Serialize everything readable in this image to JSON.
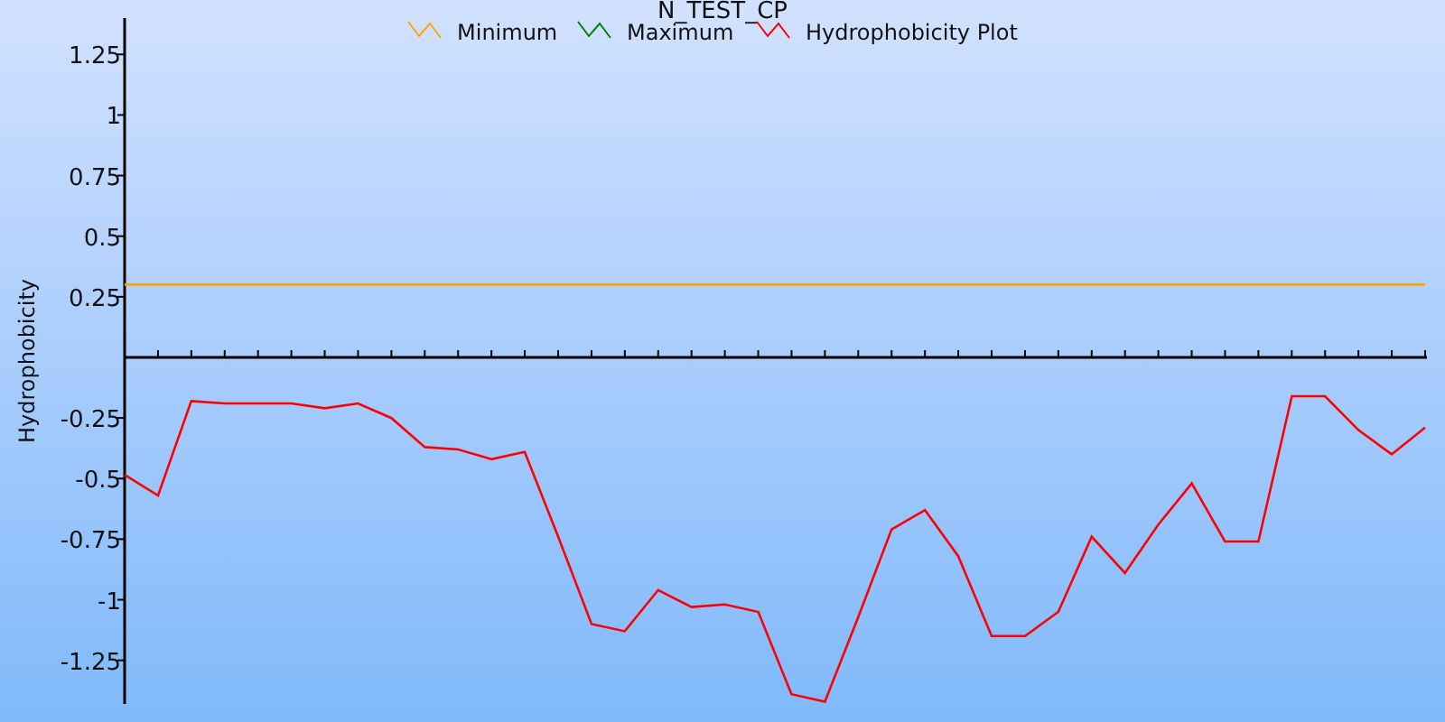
{
  "chart_data": {
    "type": "line",
    "title": "N_TEST_CP",
    "ylabel": "Hydrophobicity",
    "legend": "top",
    "ylim": [
      -1.43,
      1.4
    ],
    "yticks": [
      1.25,
      1,
      0.75,
      0.5,
      0.25,
      -0.25,
      -0.5,
      -0.75,
      -1,
      -1.25
    ],
    "series": [
      {
        "name": "Minimum",
        "color": "#ffa500",
        "values": [
          0.3,
          0.3,
          0.3,
          0.3,
          0.3,
          0.3,
          0.3,
          0.3,
          0.3,
          0.3,
          0.3,
          0.3,
          0.3,
          0.3,
          0.3,
          0.3,
          0.3,
          0.3,
          0.3,
          0.3,
          0.3,
          0.3,
          0.3,
          0.3,
          0.3,
          0.3,
          0.3,
          0.3,
          0.3,
          0.3,
          0.3,
          0.3,
          0.3,
          0.3,
          0.3,
          0.3,
          0.3,
          0.3,
          0.3,
          0.3
        ]
      },
      {
        "name": "Maximum",
        "color": "#008000",
        "values": [
          null,
          null,
          null,
          null,
          null,
          null,
          null,
          null,
          null,
          null,
          null,
          null,
          null,
          null,
          null,
          null,
          null,
          null,
          null,
          null,
          null,
          null,
          null,
          null,
          null,
          null,
          null,
          null,
          null,
          null,
          null,
          null,
          null,
          null,
          null,
          null,
          null,
          null,
          null,
          null
        ]
      },
      {
        "name": "Hydrophobicity Plot",
        "color": "#ff0000",
        "values": [
          -0.485,
          -0.57,
          -0.18,
          -0.19,
          -0.19,
          -0.19,
          -0.21,
          -0.19,
          -0.25,
          -0.37,
          -0.38,
          -0.42,
          -0.39,
          -0.74,
          -1.1,
          -1.13,
          -0.96,
          -1.03,
          -1.02,
          -1.05,
          -1.39,
          -1.42,
          -1.07,
          -0.71,
          -0.63,
          -0.82,
          -1.15,
          -1.15,
          -1.05,
          -0.74,
          -0.89,
          -0.69,
          -0.52,
          -0.76,
          -0.76,
          -0.16,
          -0.16,
          -0.3,
          -0.4,
          -0.29
        ]
      }
    ]
  }
}
